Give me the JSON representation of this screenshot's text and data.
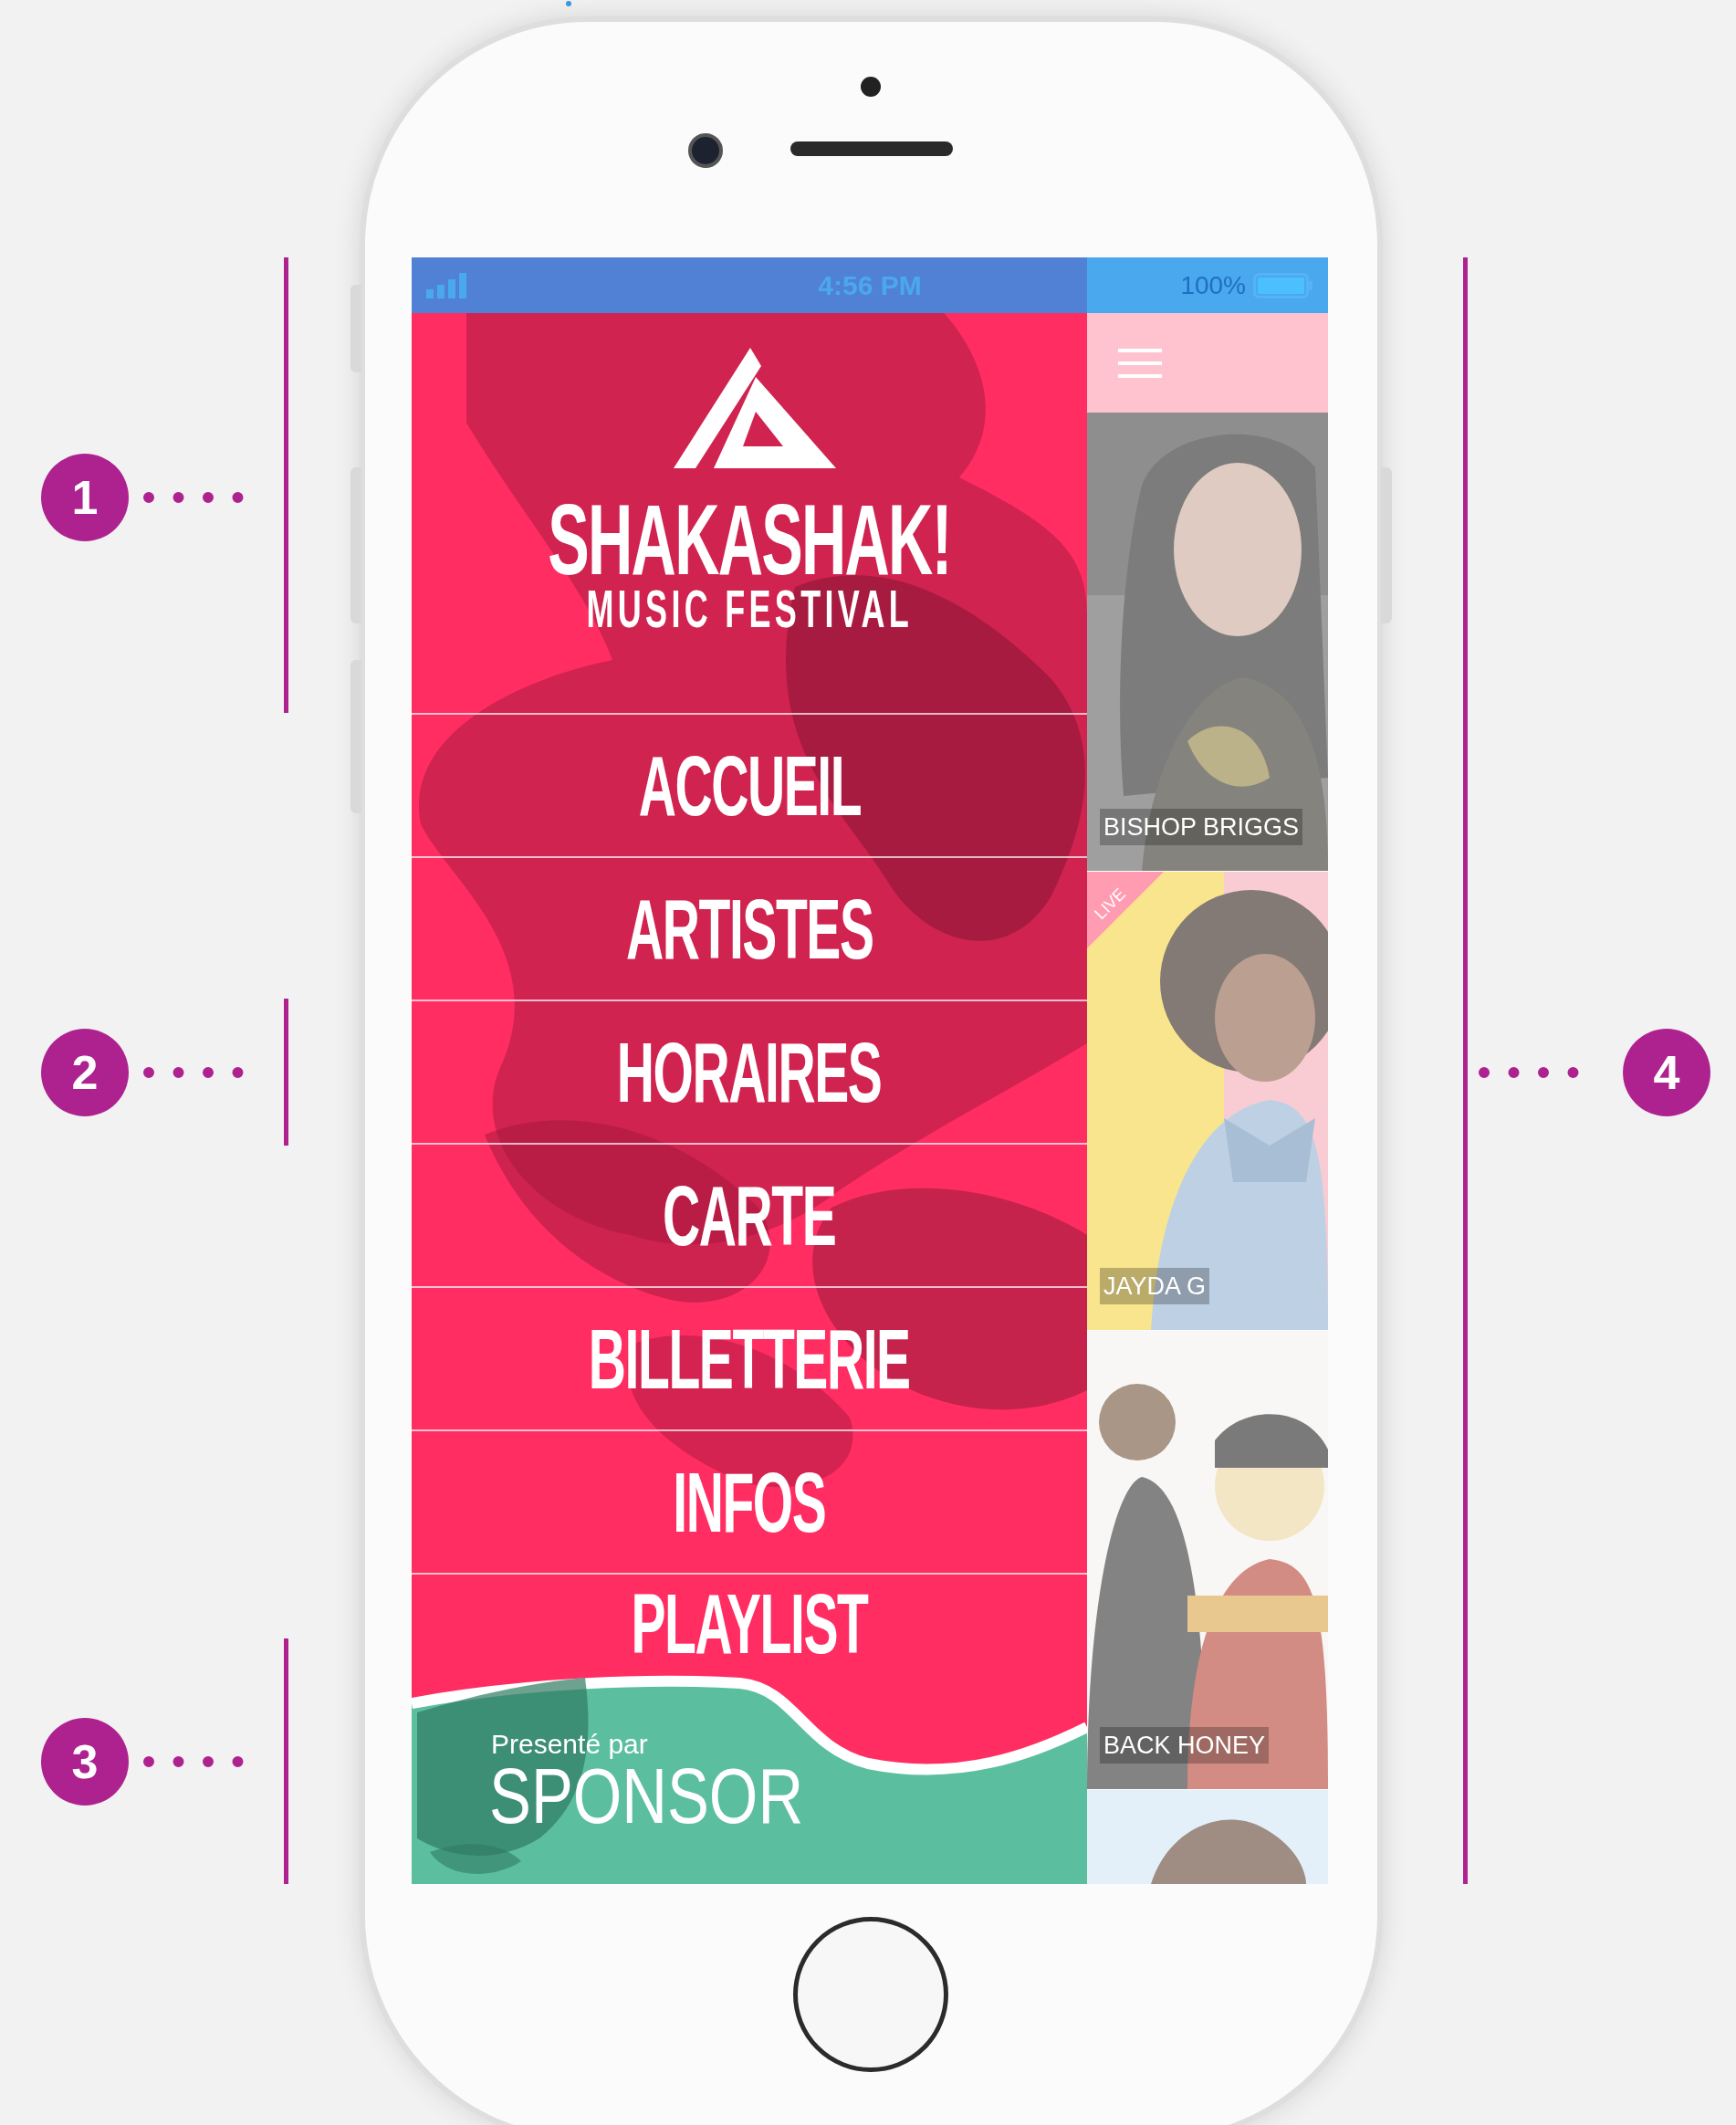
{
  "callouts": [
    {
      "label": "1"
    },
    {
      "label": "2"
    },
    {
      "label": "3"
    },
    {
      "label": "4"
    }
  ],
  "status_bar": {
    "time": "4:56 PM",
    "battery": "100%"
  },
  "logo": {
    "title": "SHAKASHAK!",
    "subtitle": "MUSIC FESTIVAL"
  },
  "menu": [
    {
      "label": "ACCUEIL"
    },
    {
      "label": "ARTISTES"
    },
    {
      "label": "HORAIRES"
    },
    {
      "label": "CARTE"
    },
    {
      "label": "BILLETTERIE"
    },
    {
      "label": "INFOS"
    },
    {
      "label": "PLAYLIST"
    }
  ],
  "sponsor": {
    "caption": "Presenté par",
    "name": "SPONSOR"
  },
  "artists": [
    {
      "name": "BISHOP BRIGGS",
      "live": false
    },
    {
      "name": "JAYDA G",
      "live": true,
      "badge": "LIVE"
    },
    {
      "name": "BACK HONEY",
      "live": false
    }
  ]
}
